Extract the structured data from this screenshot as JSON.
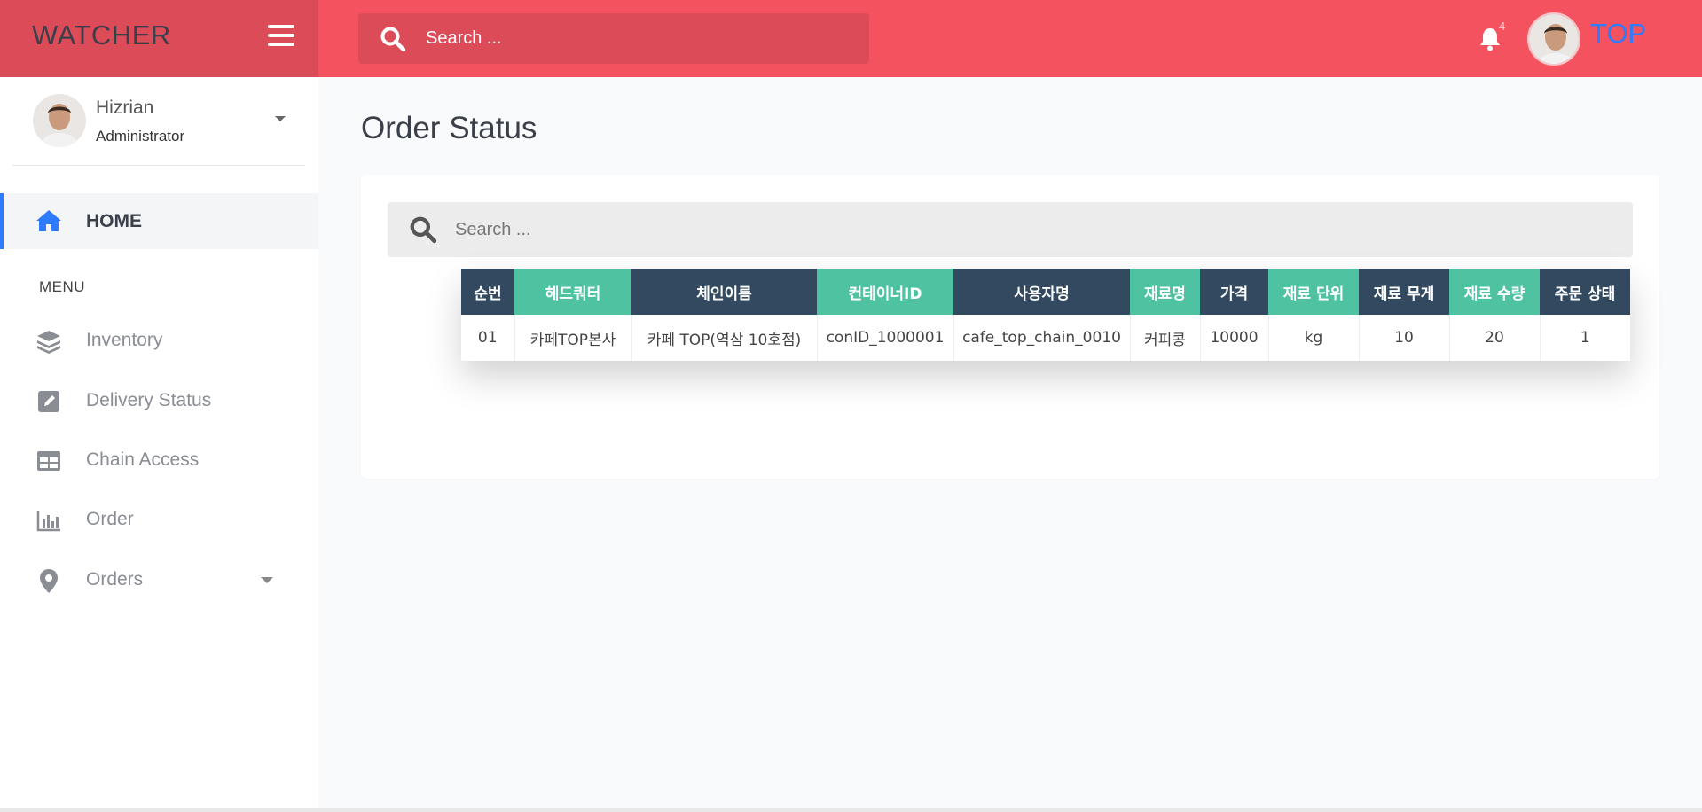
{
  "brand": {
    "name": "WATCHER"
  },
  "topbar": {
    "search_placeholder": "Search ...",
    "notification_count": "4",
    "user_label": "TOP"
  },
  "profile": {
    "name": "Hizrian",
    "role": "Administrator"
  },
  "nav": {
    "home": "HOME",
    "menu_heading": "MENU",
    "items": [
      {
        "label": "Inventory",
        "icon": "layers-icon"
      },
      {
        "label": "Delivery Status",
        "icon": "edit-icon"
      },
      {
        "label": "Chain Access",
        "icon": "table-icon"
      },
      {
        "label": "Order",
        "icon": "bar-chart-icon"
      },
      {
        "label": "Orders",
        "icon": "map-pin-icon"
      }
    ]
  },
  "main": {
    "title": "Order Status",
    "search_placeholder": "Search ..."
  },
  "table": {
    "headers": [
      "순번",
      "헤드쿼터",
      "체인이름",
      "컨테이너ID",
      "사용자명",
      "재료명",
      "가격",
      "재료 단위",
      "재료 무게",
      "재료 수량",
      "주문 상태"
    ],
    "rows": [
      [
        "01",
        "카페TOP본사",
        "카페 TOP(역삼 10호점)",
        "conID_1000001",
        "cafe_top_chain_0010",
        "커피콩",
        "10000",
        "kg",
        "10",
        "20",
        "1"
      ]
    ]
  },
  "colors": {
    "topbar": "#f4525f",
    "brand_bg": "#dc4c58",
    "header_dark": "#324960",
    "header_teal": "#4fc3a1",
    "accent": "#2e7bff"
  }
}
